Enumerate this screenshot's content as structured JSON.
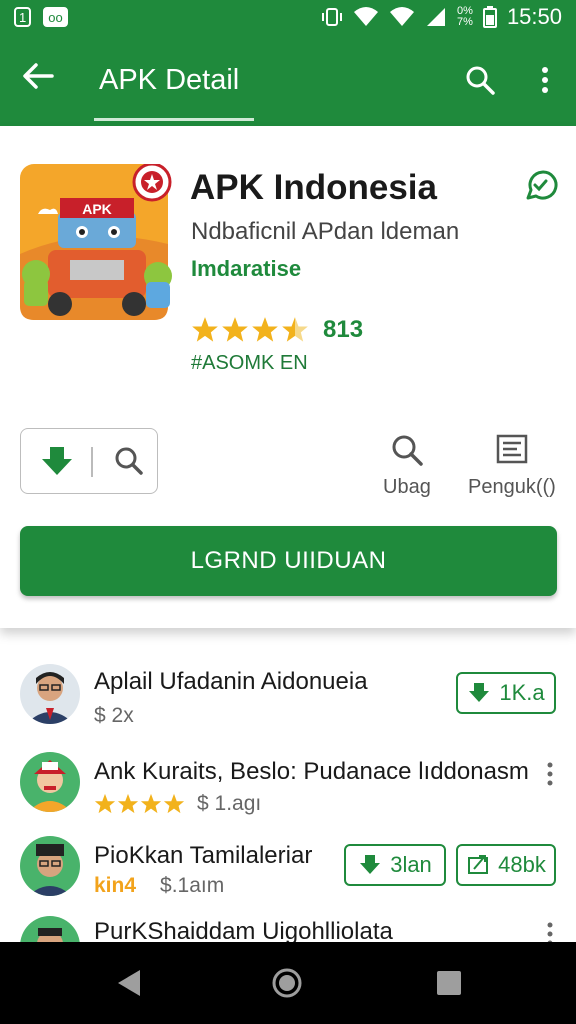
{
  "status_bar": {
    "left_text": "1",
    "time": "15:50",
    "battery_top": "0%",
    "battery_bottom": "7%"
  },
  "app_bar": {
    "title": "APK Detail",
    "color": "#1f8a3c"
  },
  "app": {
    "icon_label": "APK",
    "name": "APK Indonesia",
    "subtitle": "Ndbaficnil APdan ldeman",
    "category": "Imdaratise",
    "rating_value": 3.5,
    "rating_text": "813",
    "tag": "#ASOMK EN"
  },
  "actions": {
    "side": [
      {
        "label": "Ubag",
        "icon": "search-icon"
      },
      {
        "label": "Penguk(()",
        "icon": "report-icon"
      }
    ],
    "install_label": "LGRND UIIDUAN"
  },
  "list": [
    {
      "title": "Aplail Ufadanin Aidonueia",
      "sub": "$ 2x",
      "pills": [
        "1K.a"
      ]
    },
    {
      "title": "Ank Kuraits, Beslo: Pudanace lıddonasm",
      "stars": 4,
      "sub": "$ 1.agı"
    },
    {
      "title": "PioKkan Tamilaleriar",
      "sub_prefix": "kin4",
      "sub": "$.1aım",
      "pills": [
        "3lan",
        "48bk"
      ]
    },
    {
      "title": "PurKShaiddam Uigohlliolata"
    }
  ]
}
